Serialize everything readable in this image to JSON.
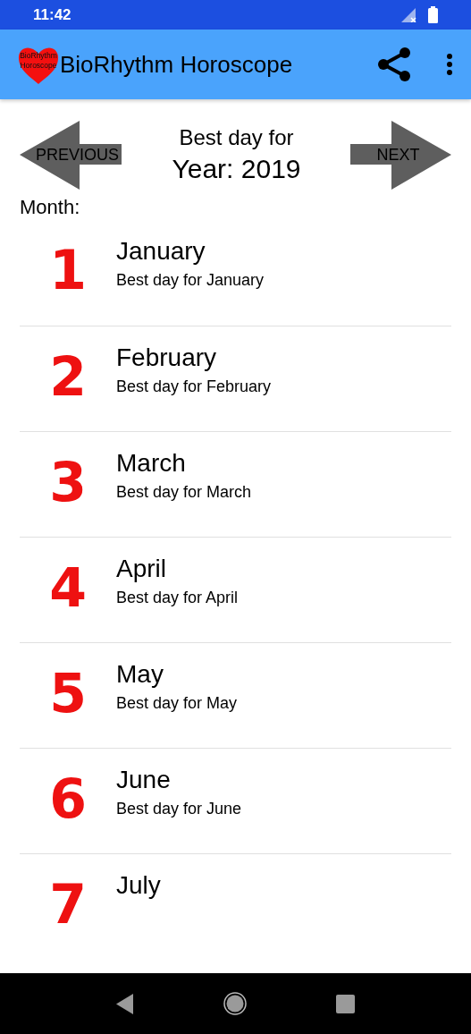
{
  "status_bar": {
    "time": "11:42"
  },
  "app_bar": {
    "logo_text": [
      "BioRhythm",
      "Horoscope"
    ],
    "title": "BioRhythm Horoscope"
  },
  "navigation": {
    "previous": "PREVIOUS",
    "next": "NEXT",
    "heading": "Best day for",
    "year": "Year: 2019"
  },
  "month_label": "Month:",
  "months": [
    {
      "number": "1",
      "name": "January",
      "subtitle": "Best day for January"
    },
    {
      "number": "2",
      "name": "February",
      "subtitle": "Best day for February"
    },
    {
      "number": "3",
      "name": "March",
      "subtitle": "Best day for March"
    },
    {
      "number": "4",
      "name": "April",
      "subtitle": "Best day for April"
    },
    {
      "number": "5",
      "name": "May",
      "subtitle": "Best day for May"
    },
    {
      "number": "6",
      "name": "June",
      "subtitle": "Best day for June"
    },
    {
      "number": "7",
      "name": "July"
    }
  ]
}
